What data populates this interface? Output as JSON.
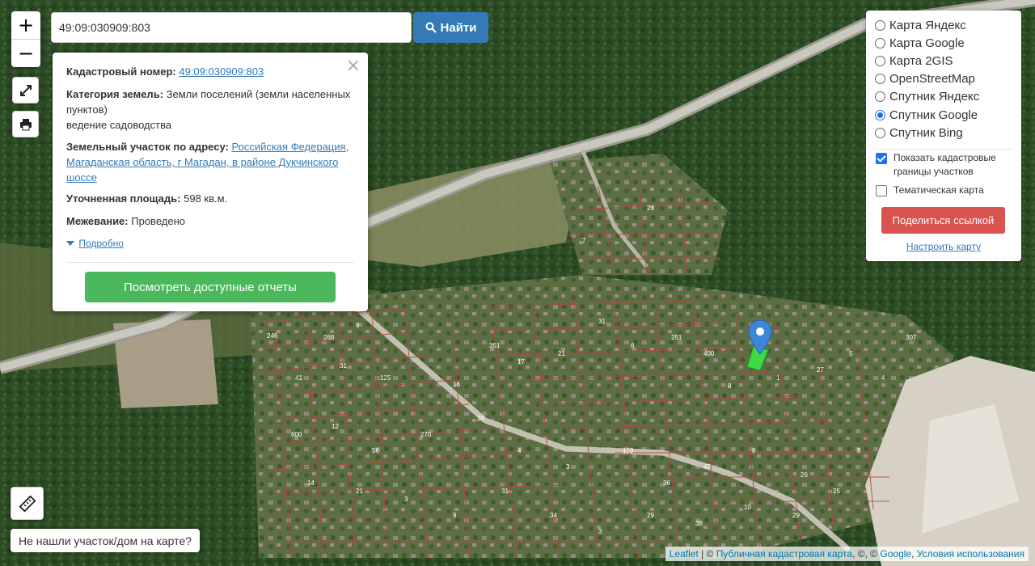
{
  "search": {
    "value": "49:09:030909:803",
    "button_label": "Найти"
  },
  "zoom": {
    "in_label": "+",
    "out_label": "−"
  },
  "popup": {
    "cadastral_label": "Кадастровый номер:",
    "cadastral_number": "49:09:030909:803",
    "category_label": "Категория земель:",
    "category_value": "Земли поселений (земли населенных пунктов)",
    "category_use": "ведение садоводства",
    "address_label": "Земельный участок по адресу:",
    "address_value": "Российская Федерация, Магаданская область, г Магадан, в районе Дукчинского шоссе",
    "area_label": "Уточненная площадь:",
    "area_value": "598 кв.м.",
    "survey_label": "Межевание:",
    "survey_value": "Проведено",
    "more_label": "Подробно",
    "reports_button": "Посмотреть доступные отчеты",
    "close_glyph": "×"
  },
  "layers": {
    "options": [
      {
        "label": "Карта Яндекс",
        "selected": false
      },
      {
        "label": "Карта Google",
        "selected": false
      },
      {
        "label": "Карта 2GIS",
        "selected": false
      },
      {
        "label": "OpenStreetMap",
        "selected": false
      },
      {
        "label": "Спутник Яндекс",
        "selected": false
      },
      {
        "label": "Спутник Google",
        "selected": true
      },
      {
        "label": "Спутник Bing",
        "selected": false
      }
    ],
    "show_borders_label": "Показать кадастровые границы участков",
    "show_borders_checked": true,
    "thematic_label": "Тематическая карта",
    "thematic_checked": false,
    "share_button": "Поделиться ссылкой",
    "setup_link": "Настроить карту"
  },
  "not_found_button": "Не нашли участок/дом на карте?",
  "attribution": {
    "leaflet": "Leaflet",
    "sep1": " | © ",
    "pkk": "Публичная кадастровая карта",
    "sep2": ", ©, © ",
    "google": "Google",
    "sep3": ", ",
    "terms": "Условия использования"
  },
  "parcel_labels": [
    "246",
    "268",
    "9",
    "41",
    "31",
    "125",
    "16",
    "351",
    "17",
    "21",
    "31",
    "6",
    "251",
    "400",
    "8",
    "1",
    "27",
    "5",
    "4",
    "307",
    "600",
    "12",
    "56",
    "270",
    "28",
    "4",
    "3",
    "133",
    "36",
    "47",
    "8",
    "26",
    "25",
    "8",
    "14",
    "21",
    "3",
    "9",
    "31",
    "34",
    "3",
    "29",
    "38",
    "10",
    "29",
    "7",
    "23"
  ],
  "colors": {
    "accent_blue": "#337ab7",
    "green_button": "#4cb85c",
    "red_button": "#d9534f",
    "parcel_border": "#b8463e",
    "marker": "#3a86d8",
    "selected_parcel": "#3ddb45"
  }
}
